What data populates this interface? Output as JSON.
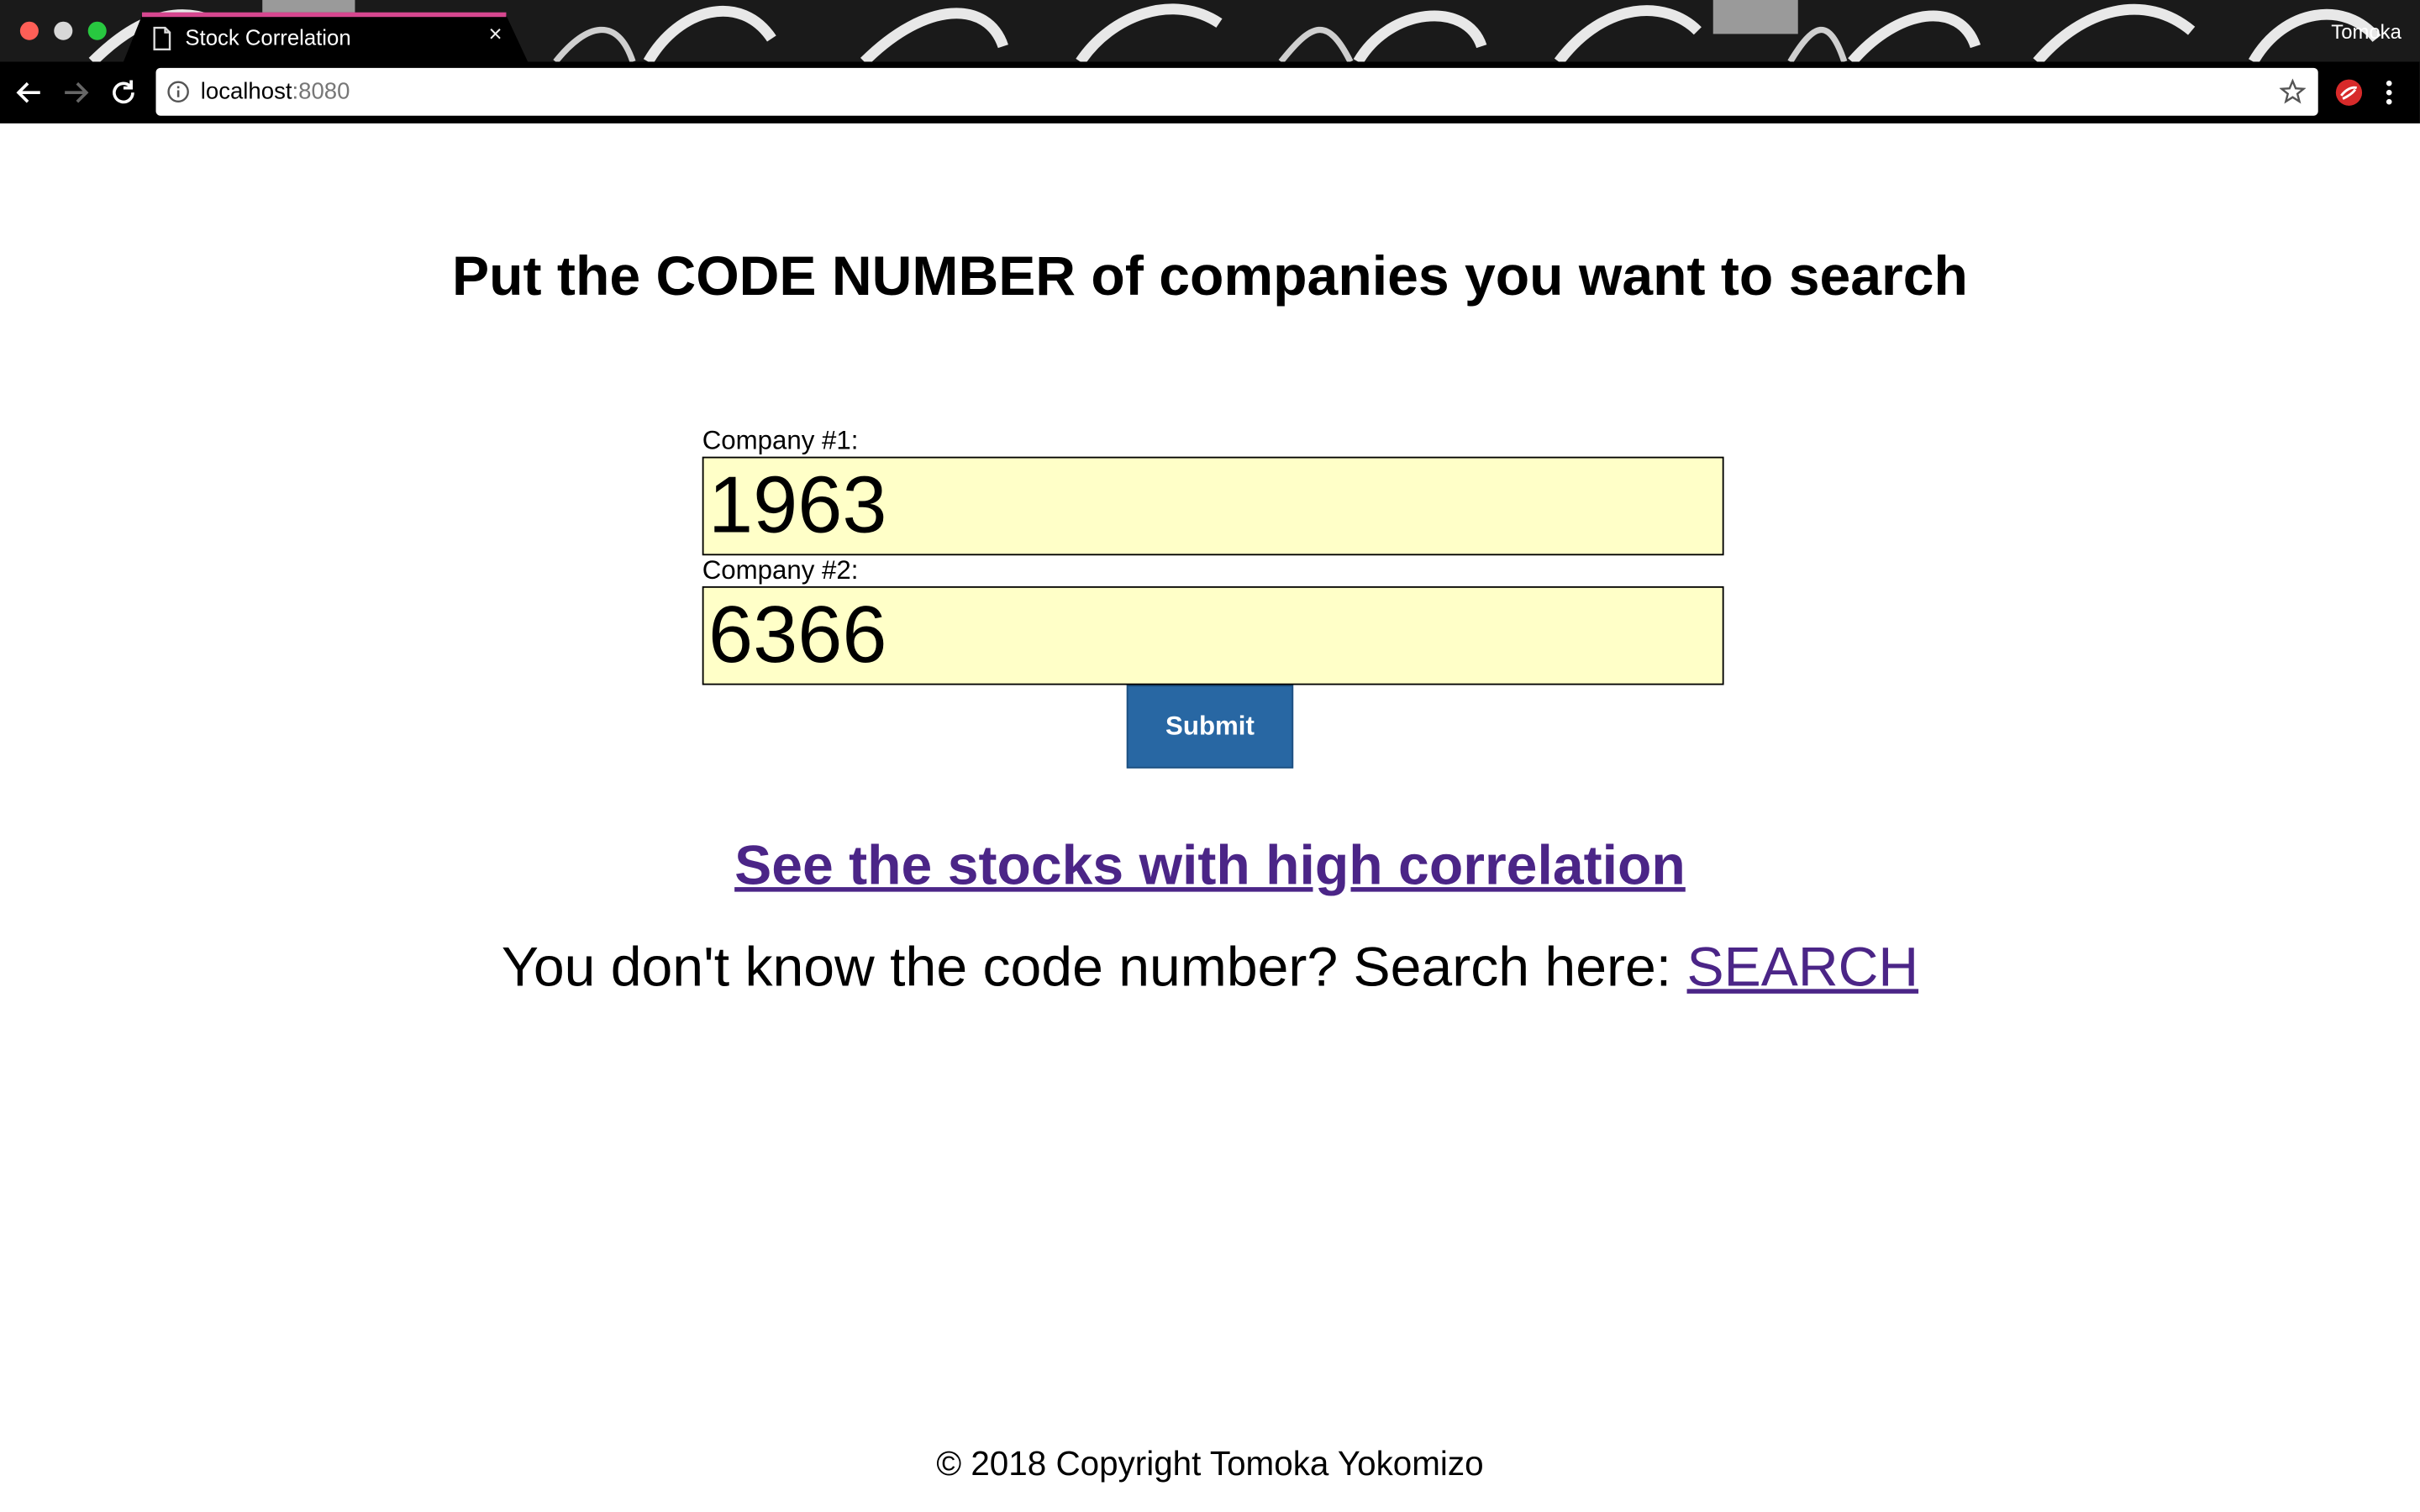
{
  "browser": {
    "tab_title": "Stock Correlation",
    "tab_close": "×",
    "profile_name": "Tomoka",
    "url_host": "localhost",
    "url_port": ":8080"
  },
  "main": {
    "heading": "Put the CODE NUMBER of companies you want to search",
    "company1": {
      "label": "Company #1:",
      "value": "1963"
    },
    "company2": {
      "label": "Company #2:",
      "value": "6366"
    },
    "submit_label": "Submit",
    "high_corr_link": "See the stocks with high correlation",
    "search_prompt": "You don't know the code number? Search here:",
    "search_link": "SEARCH"
  },
  "footer": {
    "copyright": "© 2018 Copyright Tomoka Yokomizo"
  },
  "colors": {
    "input_bg": "#ffffc8",
    "submit_bg": "#2867a3",
    "link": "#4b2587",
    "tab_accent": "#d6478f"
  }
}
